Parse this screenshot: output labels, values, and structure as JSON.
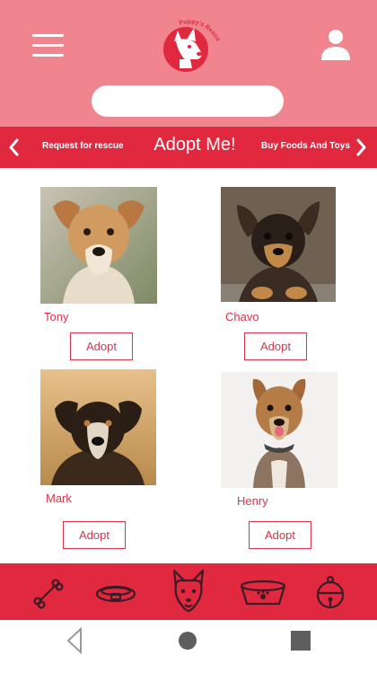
{
  "header": {
    "menu_icon": "hamburger-menu-icon",
    "logo_text": "Puppy's Rescue",
    "user_icon": "user-icon",
    "search": {
      "value": "",
      "placeholder": ""
    }
  },
  "navbar": {
    "prev_icon": "chevron-left-icon",
    "left_link": "Request for rescue",
    "title": "Adopt Me!",
    "right_link": "Buy Foods And Toys",
    "next_icon": "chevron-right-icon"
  },
  "pets": [
    {
      "name": "Tony",
      "button": "Adopt"
    },
    {
      "name": "Chavo",
      "button": "Adopt"
    },
    {
      "name": "Mark",
      "button": "Adopt"
    },
    {
      "name": "Henry",
      "button": "Adopt"
    }
  ],
  "bottom_nav": [
    "bone-icon",
    "collar-icon",
    "dog-face-icon",
    "food-bowl-icon",
    "bell-icon"
  ],
  "system_nav": [
    "back-triangle-icon",
    "home-circle-icon",
    "recent-square-icon"
  ],
  "colors": {
    "header_pink": "#f0848f",
    "accent_red": "#e0283f",
    "text_red": "#d9344b",
    "icon_dark": "#3a1b26"
  }
}
